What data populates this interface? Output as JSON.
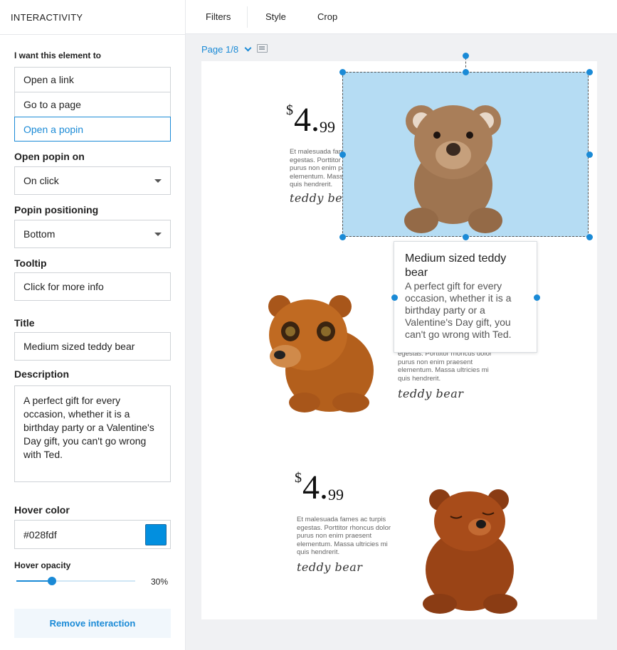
{
  "panel": {
    "title": "INTERACTIVITY",
    "want_label": "I want this element to",
    "options": [
      "Open a link",
      "Go to a page",
      "Open a popin"
    ],
    "open_on_label": "Open popin on",
    "open_on_value": "On click",
    "positioning_label": "Popin positioning",
    "positioning_value": "Bottom",
    "tooltip_label": "Tooltip",
    "tooltip_value": "Click for more info",
    "title_label": "Title",
    "title_value": "Medium sized teddy bear",
    "description_label": "Description",
    "description_value": "A perfect gift for every occasion, whether it is a birthday party or a Valentine's Day gift, you can't go wrong with Ted.",
    "hover_color_label": "Hover color",
    "hover_color_value": "#028fdf",
    "hover_opacity_label": "Hover opacity",
    "hover_opacity_value": "30%",
    "hover_opacity_fraction": 0.3,
    "remove_label": "Remove interaction"
  },
  "toolbar": {
    "filters": "Filters",
    "style": "Style",
    "crop": "Crop"
  },
  "canvas": {
    "page_label": "Page 1/8",
    "products": [
      {
        "dollar": "$",
        "price_main": "4.",
        "price_cents": "99",
        "text": "Et malesuada fames ac turpis egestas. Porttitor rhoncus dolor purus non enim praesent elementum. Massa ultricies mi quis hendrerit.",
        "script": "teddy bear"
      },
      {
        "text": "egestas. Porttitor rhoncus dolor purus non enim praesent elementum. Massa ultricies mi quis hendrerit.",
        "script": "teddy bear"
      },
      {
        "dollar": "$",
        "price_main": "4.",
        "price_cents": "99",
        "text": "Et malesuada fames ac turpis egestas. Porttitor rhoncus dolor purus non enim praesent elementum. Massa ultricies mi quis hendrerit.",
        "script": "teddy bear"
      }
    ],
    "popin": {
      "title": "Medium sized teddy bear",
      "description": "A perfect gift for every occasion, whether it is a birthday party or a Valentine's Day gift, you can't go wrong with Ted."
    }
  },
  "colors": {
    "accent": "#1a8ad6",
    "selection_fill": "#b5dcf3",
    "swatch": "#028fdf"
  }
}
